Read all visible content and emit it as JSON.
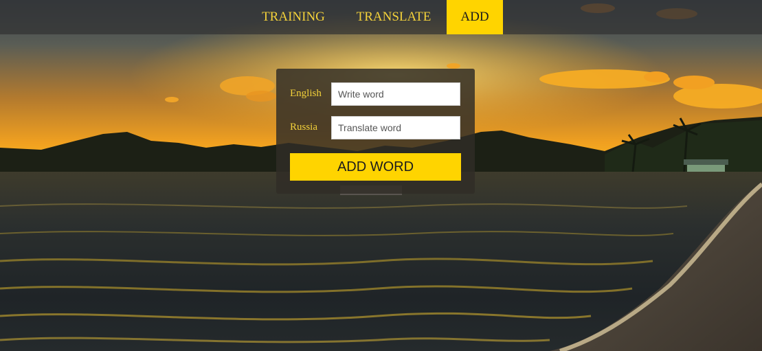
{
  "nav": {
    "items": [
      {
        "label": "TRAINING"
      },
      {
        "label": "TRANSLATE"
      },
      {
        "label": "ADD",
        "active": true
      }
    ]
  },
  "form": {
    "english": {
      "label": "English",
      "placeholder": "Write word",
      "value": ""
    },
    "russia": {
      "label": "Russia",
      "placeholder": "Translate word",
      "value": ""
    },
    "submit_label": "ADD WORD"
  },
  "colors": {
    "accent": "#ffd400",
    "label_text": "#f4d23a",
    "nav_bar": "#323232",
    "panel": "#302c26"
  }
}
